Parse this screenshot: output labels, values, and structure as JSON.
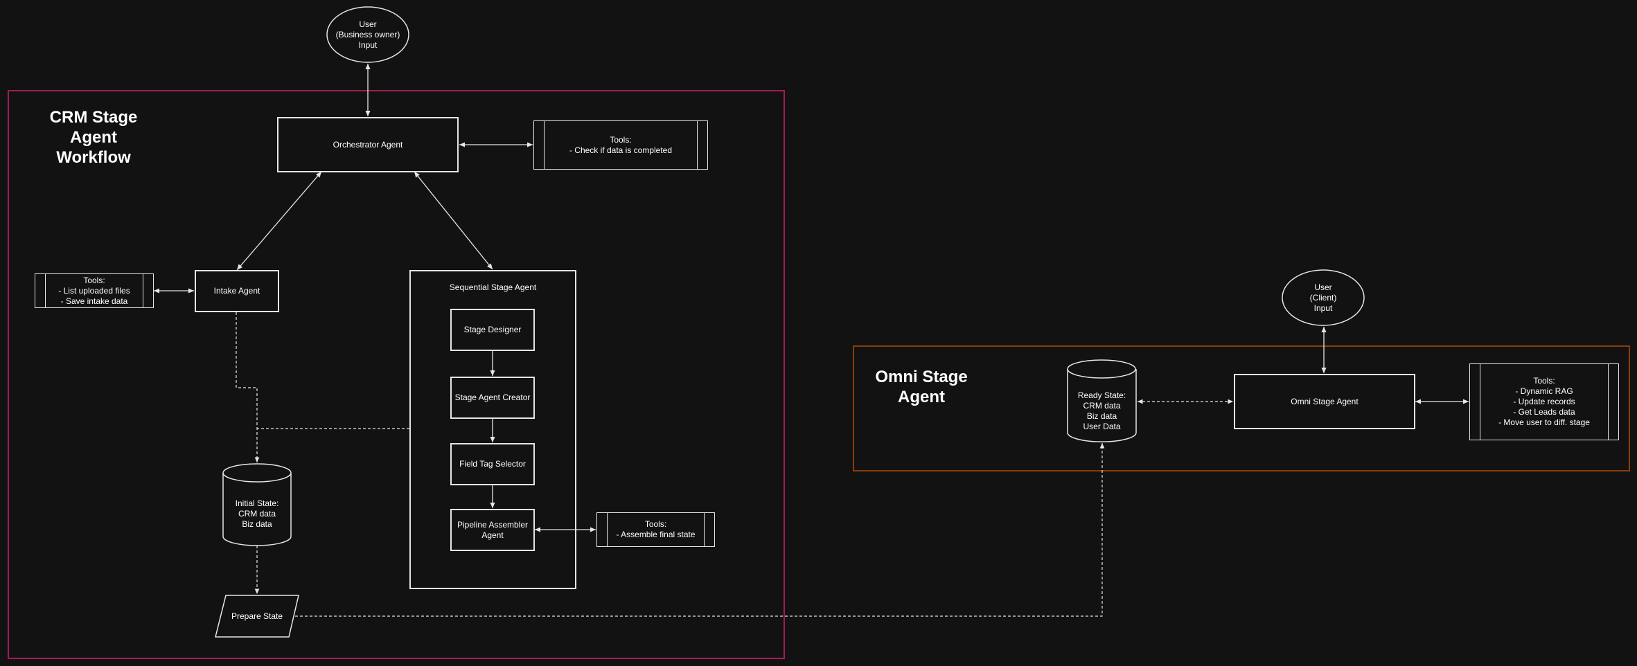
{
  "crm_group": {
    "title": "CRM Stage\nAgent\nWorkflow",
    "border_color": "#a6195a"
  },
  "omni_group": {
    "title": "Omni Stage\nAgent",
    "border_color": "#8a3e0c"
  },
  "nodes": {
    "user_business": "User\n(Business owner)\nInput",
    "orchestrator": "Orchestrator Agent",
    "orchestrator_tools": "Tools:\n- Check if data is completed",
    "intake": "Intake Agent",
    "intake_tools": "Tools:\n- List uploaded files\n- Save intake data",
    "sequential_stage_agent": "Sequential Stage Agent",
    "stage_designer": "Stage Designer",
    "stage_agent_creator": "Stage Agent Creator",
    "field_tag_selector": "Field Tag Selector",
    "pipeline_assembler": "Pipeline Assembler\nAgent",
    "pipeline_tools": "Tools:\n- Assemble final state",
    "initial_state": "Initial State:\nCRM data\nBiz data",
    "prepare_state": "Prepare State",
    "user_client": "User\n(Client)\nInput",
    "ready_state": "Ready State:\nCRM data\nBiz data\nUser Data",
    "omni_agent": "Omni Stage Agent",
    "omni_tools": "Tools:\n- Dynamic RAG\n- Update records\n- Get Leads data\n- Move user to diff. stage"
  },
  "line_color": "#e6e6e6"
}
